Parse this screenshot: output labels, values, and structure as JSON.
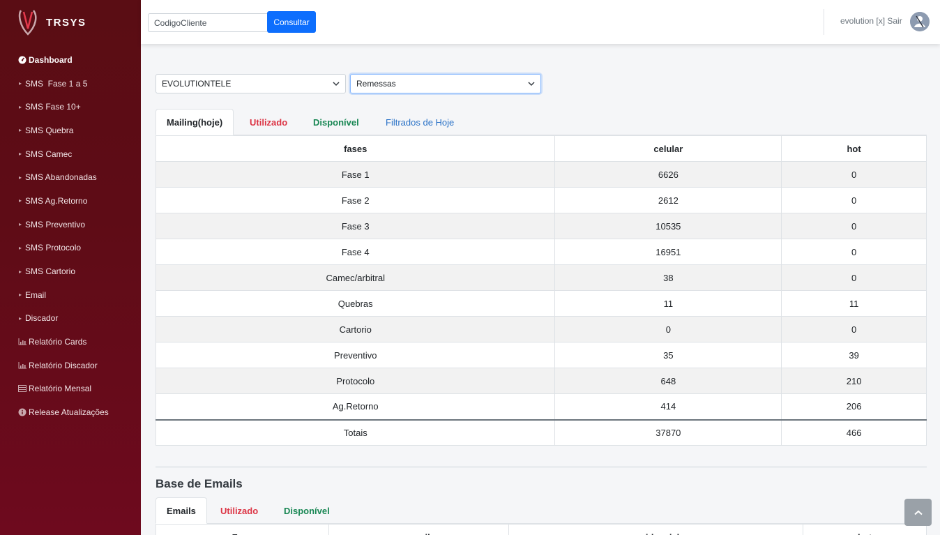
{
  "sidebar": {
    "brand": "TRSYS",
    "items": [
      {
        "label": "Dashboard",
        "icon": "gauge-icon"
      },
      {
        "label": "SMS  Fase 1 a 5",
        "icon": "caret-right-icon"
      },
      {
        "label": "SMS Fase 10+",
        "icon": "caret-right-icon"
      },
      {
        "label": "SMS Quebra",
        "icon": "caret-right-icon"
      },
      {
        "label": "SMS Camec",
        "icon": "caret-right-icon"
      },
      {
        "label": "SMS Abandonadas",
        "icon": "caret-right-icon"
      },
      {
        "label": "SMS Ag.Retorno",
        "icon": "caret-right-icon"
      },
      {
        "label": "SMS Preventivo",
        "icon": "caret-right-icon"
      },
      {
        "label": "SMS Protocolo",
        "icon": "caret-right-icon"
      },
      {
        "label": "SMS Cartorio",
        "icon": "caret-right-icon"
      },
      {
        "label": "Email",
        "icon": "caret-right-icon"
      },
      {
        "label": "Discador",
        "icon": "caret-right-icon"
      },
      {
        "label": "Relatório Cards",
        "icon": "bar-chart-icon"
      },
      {
        "label": "Relatório Discador",
        "icon": "bar-chart-icon"
      },
      {
        "label": "Relatório Mensal",
        "icon": "list-icon"
      },
      {
        "label": "Release Atualizações",
        "icon": "info-icon"
      }
    ]
  },
  "header": {
    "search_value": "CodigoCliente",
    "search_button": "Consultar",
    "user_text": "evolution [x] Sair"
  },
  "filters": {
    "company": "EVOLUTIONTELE",
    "type": "Remessas"
  },
  "mailing": {
    "tabs": [
      "Mailing(hoje)",
      "Utilizado",
      "Disponível",
      "Filtrados de Hoje"
    ],
    "columns": [
      "fases",
      "celular",
      "hot"
    ],
    "rows": [
      [
        "Fase 1",
        "6626",
        "0"
      ],
      [
        "Fase 2",
        "2612",
        "0"
      ],
      [
        "Fase 3",
        "10535",
        "0"
      ],
      [
        "Fase 4",
        "16951",
        "0"
      ],
      [
        "Camec/arbitral",
        "38",
        "0"
      ],
      [
        "Quebras",
        "11",
        "11"
      ],
      [
        "Cartorio",
        "0",
        "0"
      ],
      [
        "Preventivo",
        "35",
        "39"
      ],
      [
        "Protocolo",
        "648",
        "210"
      ],
      [
        "Ag.Retorno",
        "414",
        "206"
      ]
    ],
    "totals": [
      "Totais",
      "37870",
      "466"
    ]
  },
  "emails": {
    "title": "Base de Emails",
    "tabs": [
      "Emails",
      "Utilizado",
      "Disponível"
    ],
    "columns": [
      "Fase",
      "email",
      "residencial",
      "hot"
    ]
  },
  "colors": {
    "sidebar": "#5e0c16",
    "primary": "#0d6efd",
    "danger": "#dc3545",
    "success": "#198754",
    "link": "#2a72c7"
  }
}
